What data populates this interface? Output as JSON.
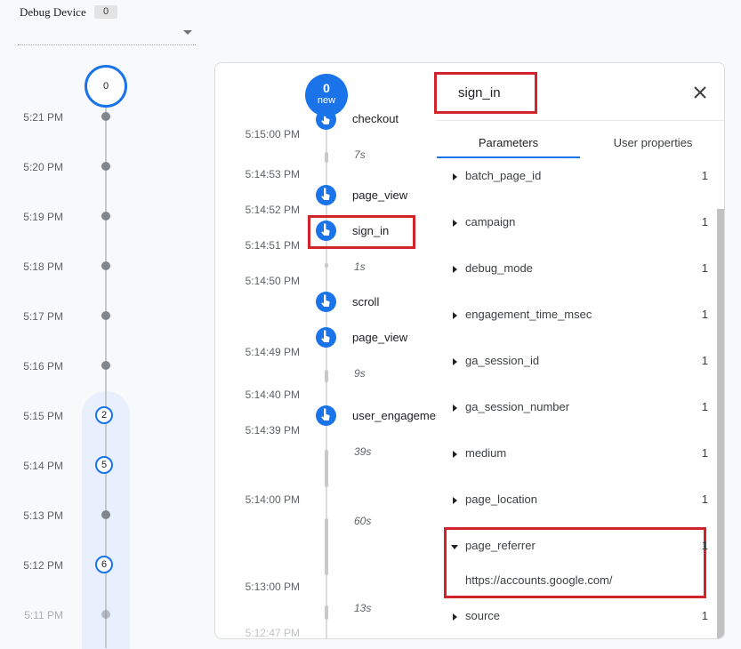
{
  "device": {
    "label": "Debug Device",
    "count": "0"
  },
  "top_counter": "0",
  "minutes": [
    {
      "time": "5:21 PM",
      "count": null
    },
    {
      "time": "5:20 PM",
      "count": null
    },
    {
      "time": "5:19 PM",
      "count": null
    },
    {
      "time": "5:18 PM",
      "count": null
    },
    {
      "time": "5:17 PM",
      "count": null
    },
    {
      "time": "5:16 PM",
      "count": null
    },
    {
      "time": "5:15 PM",
      "count": "2"
    },
    {
      "time": "5:14 PM",
      "count": "5"
    },
    {
      "time": "5:13 PM",
      "count": null
    },
    {
      "time": "5:12 PM",
      "count": "6"
    },
    {
      "time": "5:11 PM",
      "count": null
    }
  ],
  "events_panel": {
    "new_badge": {
      "count": "0",
      "label": "new"
    },
    "timestamps": [
      "5:15:00 PM",
      "5:14:53 PM",
      "5:14:52 PM",
      "5:14:51 PM",
      "5:14:50 PM",
      "5:14:49 PM",
      "5:14:40 PM",
      "5:14:39 PM",
      "5:14:00 PM",
      "5:13:00 PM",
      "5:12:47 PM"
    ],
    "events": [
      "checkout",
      "page_view",
      "sign_in",
      "scroll",
      "page_view",
      "user_engagement"
    ],
    "gaps": [
      "7s",
      "1s",
      "9s",
      "39s",
      "60s",
      "13s"
    ]
  },
  "detail": {
    "title": "sign_in",
    "close_icon": "close-icon",
    "tabs": [
      "Parameters",
      "User properties"
    ],
    "active_tab": "Parameters",
    "params": [
      {
        "name": "batch_page_id",
        "count": "1"
      },
      {
        "name": "campaign",
        "count": "1"
      },
      {
        "name": "debug_mode",
        "count": "1"
      },
      {
        "name": "engagement_time_msec",
        "count": "1"
      },
      {
        "name": "ga_session_id",
        "count": "1"
      },
      {
        "name": "ga_session_number",
        "count": "1"
      },
      {
        "name": "medium",
        "count": "1"
      },
      {
        "name": "page_location",
        "count": "1"
      },
      {
        "name": "page_referrer",
        "count": "1",
        "expanded": true,
        "value": "https://accounts.google.com/"
      },
      {
        "name": "source",
        "count": "1"
      }
    ]
  },
  "colors": {
    "accent": "#1a73e8",
    "highlight_box": "#d1232a"
  }
}
